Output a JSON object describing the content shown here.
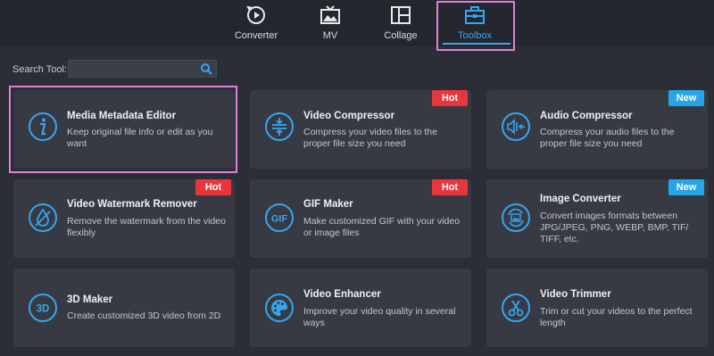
{
  "tabs": [
    {
      "label": "Converter",
      "icon": "converter-icon"
    },
    {
      "label": "MV",
      "icon": "mv-icon"
    },
    {
      "label": "Collage",
      "icon": "collage-icon"
    },
    {
      "label": "Toolbox",
      "icon": "toolbox-icon",
      "active": true
    }
  ],
  "search": {
    "label": "Search Tool:",
    "placeholder": "",
    "value": ""
  },
  "cards": [
    {
      "title": "Media Metadata Editor",
      "desc": "Keep original file info or edit as you want",
      "icon": "info-icon",
      "badge": ""
    },
    {
      "title": "Video Compressor",
      "desc": "Compress your video files to the proper file size you need",
      "icon": "compress-icon",
      "badge": "Hot"
    },
    {
      "title": "Audio Compressor",
      "desc": "Compress your audio files to the proper file size you need",
      "icon": "audio-compress-icon",
      "badge": "New"
    },
    {
      "title": "Video Watermark Remover",
      "desc": "Remove the watermark from the video flexibly",
      "icon": "watermark-drop-icon",
      "badge": "Hot"
    },
    {
      "title": "GIF Maker",
      "desc": "Make customized GIF with your video or image files",
      "icon": "gif-icon",
      "badge": "Hot"
    },
    {
      "title": "Image Converter",
      "desc": "Convert images formats between JPG/JPEG, PNG, WEBP, BMP, TIF/ TIFF, etc.",
      "icon": "image-convert-icon",
      "badge": "New"
    },
    {
      "title": "3D Maker",
      "desc": "Create customized 3D video from 2D",
      "icon": "3d-icon",
      "badge": ""
    },
    {
      "title": "Video Enhancer",
      "desc": "Improve your video quality in several ways",
      "icon": "palette-icon",
      "badge": ""
    },
    {
      "title": "Video Trimmer",
      "desc": "Trim or cut your videos to the perfect length",
      "icon": "scissors-icon",
      "badge": ""
    }
  ],
  "colors": {
    "accent": "#35a6f0",
    "hot": "#e8363c",
    "new": "#26a6ea",
    "highlight": "#e27fd8"
  }
}
